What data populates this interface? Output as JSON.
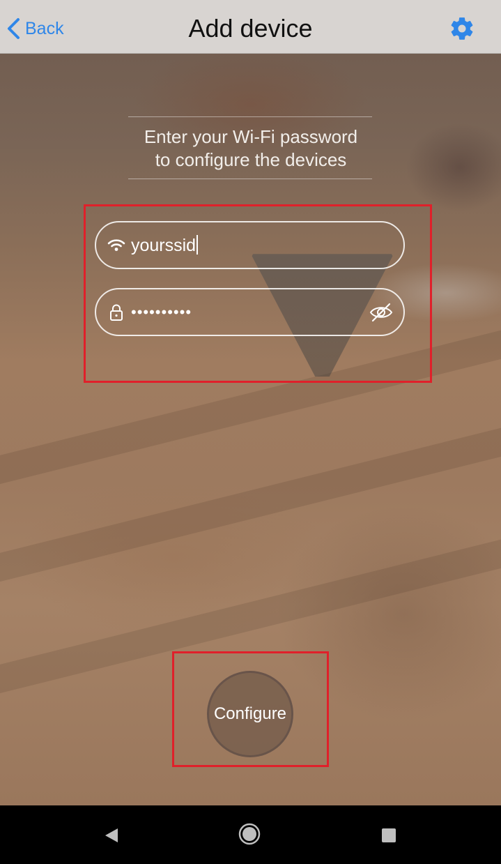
{
  "header": {
    "back_label": "Back",
    "title": "Add device",
    "accent_color": "#2f86e8",
    "settings_icon": "gear-icon"
  },
  "instruction": {
    "line1": "Enter your Wi-Fi password",
    "line2": "to configure the devices"
  },
  "ssid_field": {
    "icon": "wifi-icon",
    "value": "yourssid"
  },
  "password_field": {
    "icon": "lock-icon",
    "value": "••••••••••",
    "visibility_icon": "eye-off-icon"
  },
  "configure_button": {
    "label": "Configure"
  },
  "highlight_color": "#e0202a",
  "navbar": {
    "back_icon": "nav-back-icon",
    "home_icon": "nav-home-icon",
    "recent_icon": "nav-recent-icon"
  }
}
